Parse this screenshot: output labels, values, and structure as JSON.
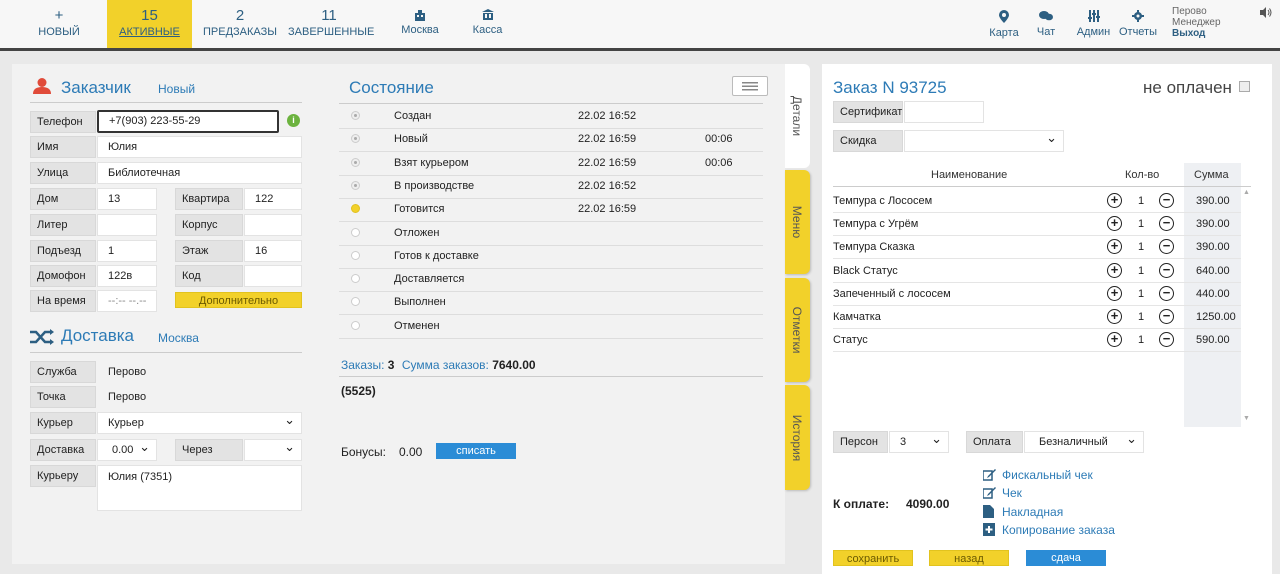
{
  "nav": {
    "new": {
      "icon": "+",
      "label": "НОВЫЙ"
    },
    "active": {
      "count": "15",
      "label": "АКТИВНЫЕ"
    },
    "preorders": {
      "count": "2",
      "label": "ПРЕДЗАКАЗЫ"
    },
    "completed": {
      "count": "11",
      "label": "ЗАВЕРШЕННЫЕ"
    },
    "city": {
      "icon": "building-icon",
      "label": "Москва"
    },
    "cash": {
      "icon": "bank-icon",
      "label": "Касса"
    }
  },
  "right_nav": {
    "map": "Карта",
    "chat": "Чат",
    "admin": "Админ",
    "reports": "Отчеты"
  },
  "user": {
    "line1": "Перово",
    "line2": "Менеджер",
    "logout": "Выход"
  },
  "customer": {
    "title": "Заказчик",
    "status": "Новый",
    "phone_label": "Телефон",
    "phone": "+7(903) 223-55-29",
    "name_label": "Имя",
    "name": "Юлия",
    "street_label": "Улица",
    "street": "Библиотечная",
    "house_label": "Дом",
    "house": "13",
    "apt_label": "Квартира",
    "apt": "122",
    "liter_label": "Литер",
    "liter": "",
    "korpus_label": "Корпус",
    "korpus": "",
    "entrance_label": "Подъезд",
    "entrance": "1",
    "floor_label": "Этаж",
    "floor": "16",
    "intercom_label": "Домофон",
    "intercom": "122в",
    "code_label": "Код",
    "code": "",
    "time_label": "На время",
    "time": "--:-- --.--",
    "extra_button": "Дополнительно"
  },
  "delivery": {
    "title": "Доставка",
    "city": "Москва",
    "service_label": "Служба",
    "service": "Перово",
    "point_label": "Точка",
    "point": "Перово",
    "courier_label": "Курьер",
    "courier": "Курьер",
    "fee_label": "Доставка",
    "fee": "0.00",
    "via_label": "Через",
    "via": "",
    "to_courier_label": "Курьеру",
    "to_courier": "Юлия (7351)"
  },
  "state": {
    "title": "Состояние",
    "rows": [
      {
        "name": "Создан",
        "time": "22.02 16:52",
        "dur": "",
        "status": "done"
      },
      {
        "name": "Новый",
        "time": "22.02 16:59",
        "dur": "00:06",
        "status": "done"
      },
      {
        "name": "Взят курьером",
        "time": "22.02 16:59",
        "dur": "00:06",
        "status": "done"
      },
      {
        "name": "В производстве",
        "time": "22.02 16:52",
        "dur": "",
        "status": "done"
      },
      {
        "name": "Готовится",
        "time": "22.02 16:59",
        "dur": "",
        "status": "current"
      },
      {
        "name": "Отложен",
        "time": "",
        "dur": "",
        "status": "empty"
      },
      {
        "name": "Готов к доставке",
        "time": "",
        "dur": "",
        "status": "empty"
      },
      {
        "name": "Доставляется",
        "time": "",
        "dur": "",
        "status": "empty"
      },
      {
        "name": "Выполнен",
        "time": "",
        "dur": "",
        "status": "empty"
      },
      {
        "name": "Отменен",
        "time": "",
        "dur": "",
        "status": "empty"
      }
    ],
    "orders_label": "Заказы:",
    "orders_count": "3",
    "orders_sum_label": "Сумма заказов:",
    "orders_sum": "7640.00",
    "client_id": "(5525)",
    "bonus_label": "Бонусы:",
    "bonus": "0.00",
    "bonus_button": "списать"
  },
  "tabs": [
    "Детали",
    "Меню",
    "Отметки",
    "История"
  ],
  "order": {
    "title": "Заказ N 93725",
    "payment_status": "не оплачен",
    "certificate_label": "Сертификат",
    "discount_label": "Скидка",
    "col_name": "Наименование",
    "col_qty": "Кол-во",
    "col_sum": "Сумма",
    "items": [
      {
        "name": "Темпура с Лососем",
        "qty": "1",
        "sum": "390.00"
      },
      {
        "name": "Темпура с Угрём",
        "qty": "1",
        "sum": "390.00"
      },
      {
        "name": "Темпура Сказка",
        "qty": "1",
        "sum": "390.00"
      },
      {
        "name": "Black Статус",
        "qty": "1",
        "sum": "640.00"
      },
      {
        "name": "Запеченный с лососем",
        "qty": "1",
        "sum": "440.00"
      },
      {
        "name": "Камчатка",
        "qty": "1",
        "sum": "1250.00"
      },
      {
        "name": "Статус",
        "qty": "1",
        "sum": "590.00"
      }
    ],
    "persons_label": "Персон",
    "persons": "3",
    "payment_label": "Оплата",
    "payment": "Безналичный",
    "to_pay_label": "К оплате:",
    "to_pay": "4090.00",
    "links": [
      "Фискальный чек",
      "Чек",
      "Накладная",
      "Копирование заказа"
    ],
    "save_button": "сохранить",
    "back_button": "назад",
    "change_button": "сдача"
  },
  "colors": {
    "accent": "#2d7bb6",
    "yellow": "#f2d12a",
    "blue_button": "#2b8cd6",
    "customer_icon": "#e04b3a"
  }
}
